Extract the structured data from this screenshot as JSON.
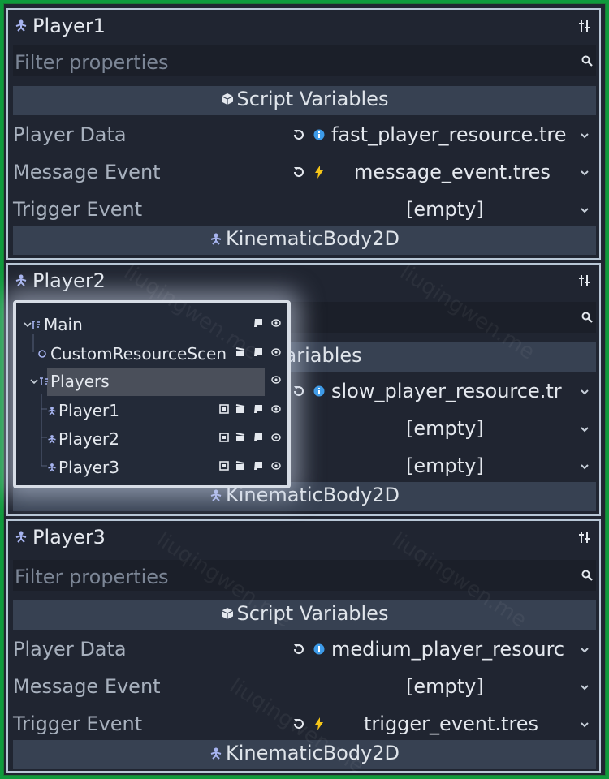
{
  "panels": [
    {
      "title": "Player1",
      "filter_placeholder": "Filter properties",
      "section": "Script Variables",
      "rows": [
        {
          "label": "Player Data",
          "value": "fast_player_resource.tre",
          "type": "info"
        },
        {
          "label": "Message Event",
          "value": "message_event.tres",
          "type": "signal"
        },
        {
          "label": "Trigger Event",
          "value": "[empty]",
          "type": "none"
        }
      ],
      "footer": "KinematicBody2D"
    },
    {
      "title": "Player2",
      "section": "Variables",
      "rows": [
        {
          "value": "slow_player_resource.tr",
          "type": "info"
        },
        {
          "value": "[empty]",
          "type": "none"
        },
        {
          "value": "[empty]",
          "type": "none"
        }
      ],
      "footer": "KinematicBody2D"
    },
    {
      "title": "Player3",
      "filter_placeholder": "Filter properties",
      "section": "Script Variables",
      "rows": [
        {
          "label": "Player Data",
          "value": "medium_player_resourc",
          "type": "info"
        },
        {
          "label": "Message Event",
          "value": "[empty]",
          "type": "none"
        },
        {
          "label": "Trigger Event",
          "value": "trigger_event.tres",
          "type": "signal"
        }
      ],
      "footer": "KinematicBody2D"
    }
  ],
  "scene_tree": [
    {
      "label": "Main"
    },
    {
      "label": "CustomResourceScen"
    },
    {
      "label": "Players"
    },
    {
      "label": "Player1"
    },
    {
      "label": "Player2"
    },
    {
      "label": "Player3"
    }
  ],
  "watermark": "liuqingwen.me",
  "colors": {
    "background": "#202531",
    "frame": "#0f9a3c",
    "accent_blue": "#3d9be9",
    "signal_yellow": "#f5c518",
    "node_icon": "#a7b4f0"
  }
}
